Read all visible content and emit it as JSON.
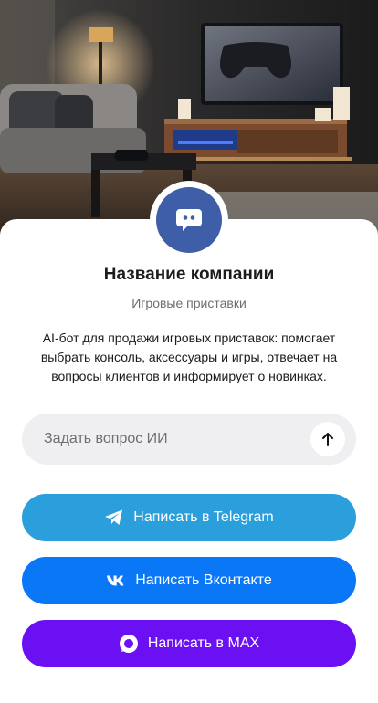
{
  "company": {
    "name": "Название компании",
    "category": "Игровые приставки",
    "description": "AI-бот для продажи игровых приставок: помогает выбрать консоль, аксессуары и игры, отвечает на вопросы клиентов и информирует о новинках."
  },
  "ask": {
    "placeholder": "Задать вопрос ИИ",
    "send_icon": "arrow-up-icon"
  },
  "buttons": {
    "telegram": {
      "label": "Написать в Telegram",
      "color": "#2a9fdc",
      "icon": "telegram-icon"
    },
    "vk": {
      "label": "Написать Вконтакте",
      "color": "#0a77f6",
      "icon": "vk-icon"
    },
    "max": {
      "label": "Написать в MAX",
      "color": "#6b10f2",
      "icon": "max-icon"
    }
  },
  "colors": {
    "avatar": "#3f5ea8"
  }
}
